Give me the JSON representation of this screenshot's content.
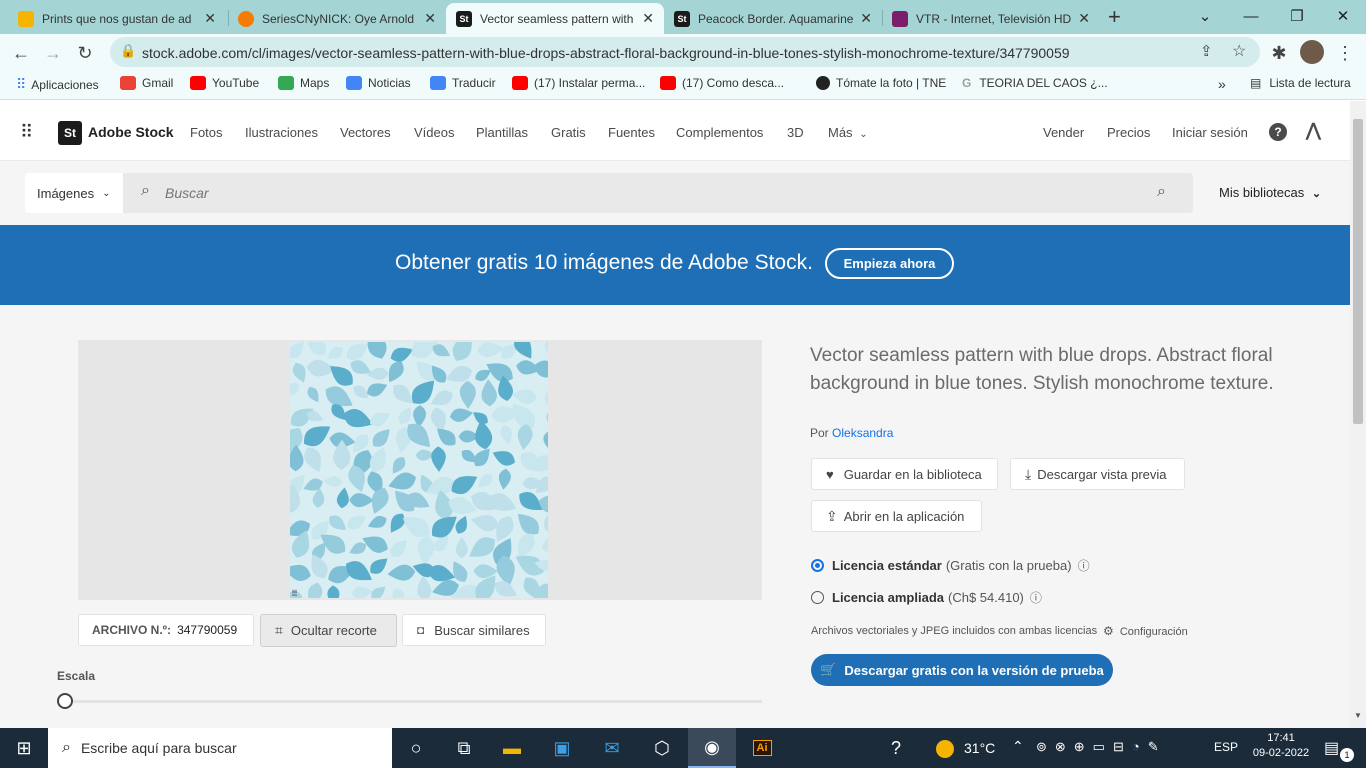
{
  "browser": {
    "tabs": [
      {
        "title": "Prints que nos gustan de ad",
        "favicon_color": "#f4b400"
      },
      {
        "title": "SeriesCNyNICK: Oye Arnold",
        "favicon_color": "#f57c00"
      },
      {
        "title": "Vector seamless pattern with",
        "favicon_color": "#1b1b1b",
        "favicon_text": "St",
        "active": true
      },
      {
        "title": "Peacock Border. Aquamarine",
        "favicon_color": "#1b1b1b",
        "favicon_text": "St"
      },
      {
        "title": "VTR - Internet, Televisión HD",
        "favicon_color": "#7b1f6b"
      }
    ],
    "new_tab": "+",
    "url": "stock.adobe.com/cl/images/vector-seamless-pattern-with-blue-drops-abstract-floral-background-in-blue-tones-stylish-monochrome-texture/347790059",
    "bookmarks": [
      {
        "label": "Aplicaciones",
        "icon_color": "#4285f4"
      },
      {
        "label": "Gmail",
        "icon_color": "#ea4335"
      },
      {
        "label": "YouTube",
        "icon_color": "#ff0000"
      },
      {
        "label": "Maps",
        "icon_color": "#34a853"
      },
      {
        "label": "Noticias",
        "icon_color": "#4285f4"
      },
      {
        "label": "Traducir",
        "icon_color": "#4285f4"
      },
      {
        "label": "(17) Instalar perma...",
        "icon_color": "#ff0000"
      },
      {
        "label": "(17) Como desca...",
        "icon_color": "#ff0000"
      },
      {
        "label": "Tómate la foto | TNE",
        "icon_color": "#222222"
      },
      {
        "label": "TEORIA DEL CAOS ¿...",
        "icon_color": "#9e9e9e"
      }
    ],
    "bookmarks_overflow": "»",
    "reading_list": "Lista de lectura"
  },
  "adobe": {
    "logo_badge": "St",
    "logo_text": "Adobe Stock",
    "nav": [
      "Fotos",
      "Ilustraciones",
      "Vectores",
      "Vídeos",
      "Plantillas",
      "Gratis",
      "Fuentes",
      "Complementos",
      "3D",
      "Más"
    ],
    "right_nav": [
      "Vender",
      "Precios",
      "Iniciar sesión"
    ],
    "search_scope": "Imágenes",
    "search_placeholder": "Buscar",
    "libraries": "Mis bibliotecas",
    "banner_text": "Obtener gratis 10 imágenes de Adobe Stock.",
    "banner_button": "Empieza ahora"
  },
  "asset": {
    "title": "Vector seamless pattern with blue drops. Abstract floral background in blue tones. Stylish monochrome texture.",
    "by_label": "Por",
    "author": "Oleksandra",
    "save_library": "Guardar en la biblioteca",
    "download_preview": "Descargar vista previa",
    "open_app": "Abrir en la aplicación",
    "license_standard": "Licencia estándar",
    "license_standard_note": "(Gratis con la prueba)",
    "license_extended": "Licencia ampliada",
    "license_extended_note": "(Ch$ 54.410)",
    "files_note": "Archivos vectoriales y JPEG incluidos con ambas licencias",
    "config": "Configuración",
    "download_trial": "Descargar gratis con la versión de prueba",
    "file_label": "ARCHIVO N.º:",
    "file_number": "347790059",
    "hide_crop": "Ocultar recorte",
    "find_similar": "Buscar similares",
    "scale_label": "Escala",
    "scale_value": 0
  },
  "taskbar": {
    "search_placeholder": "Escribe aquí para buscar",
    "weather": "31°C",
    "lang": "ESP",
    "time": "17:41",
    "date": "09-02-2022",
    "notification_count": "1"
  }
}
